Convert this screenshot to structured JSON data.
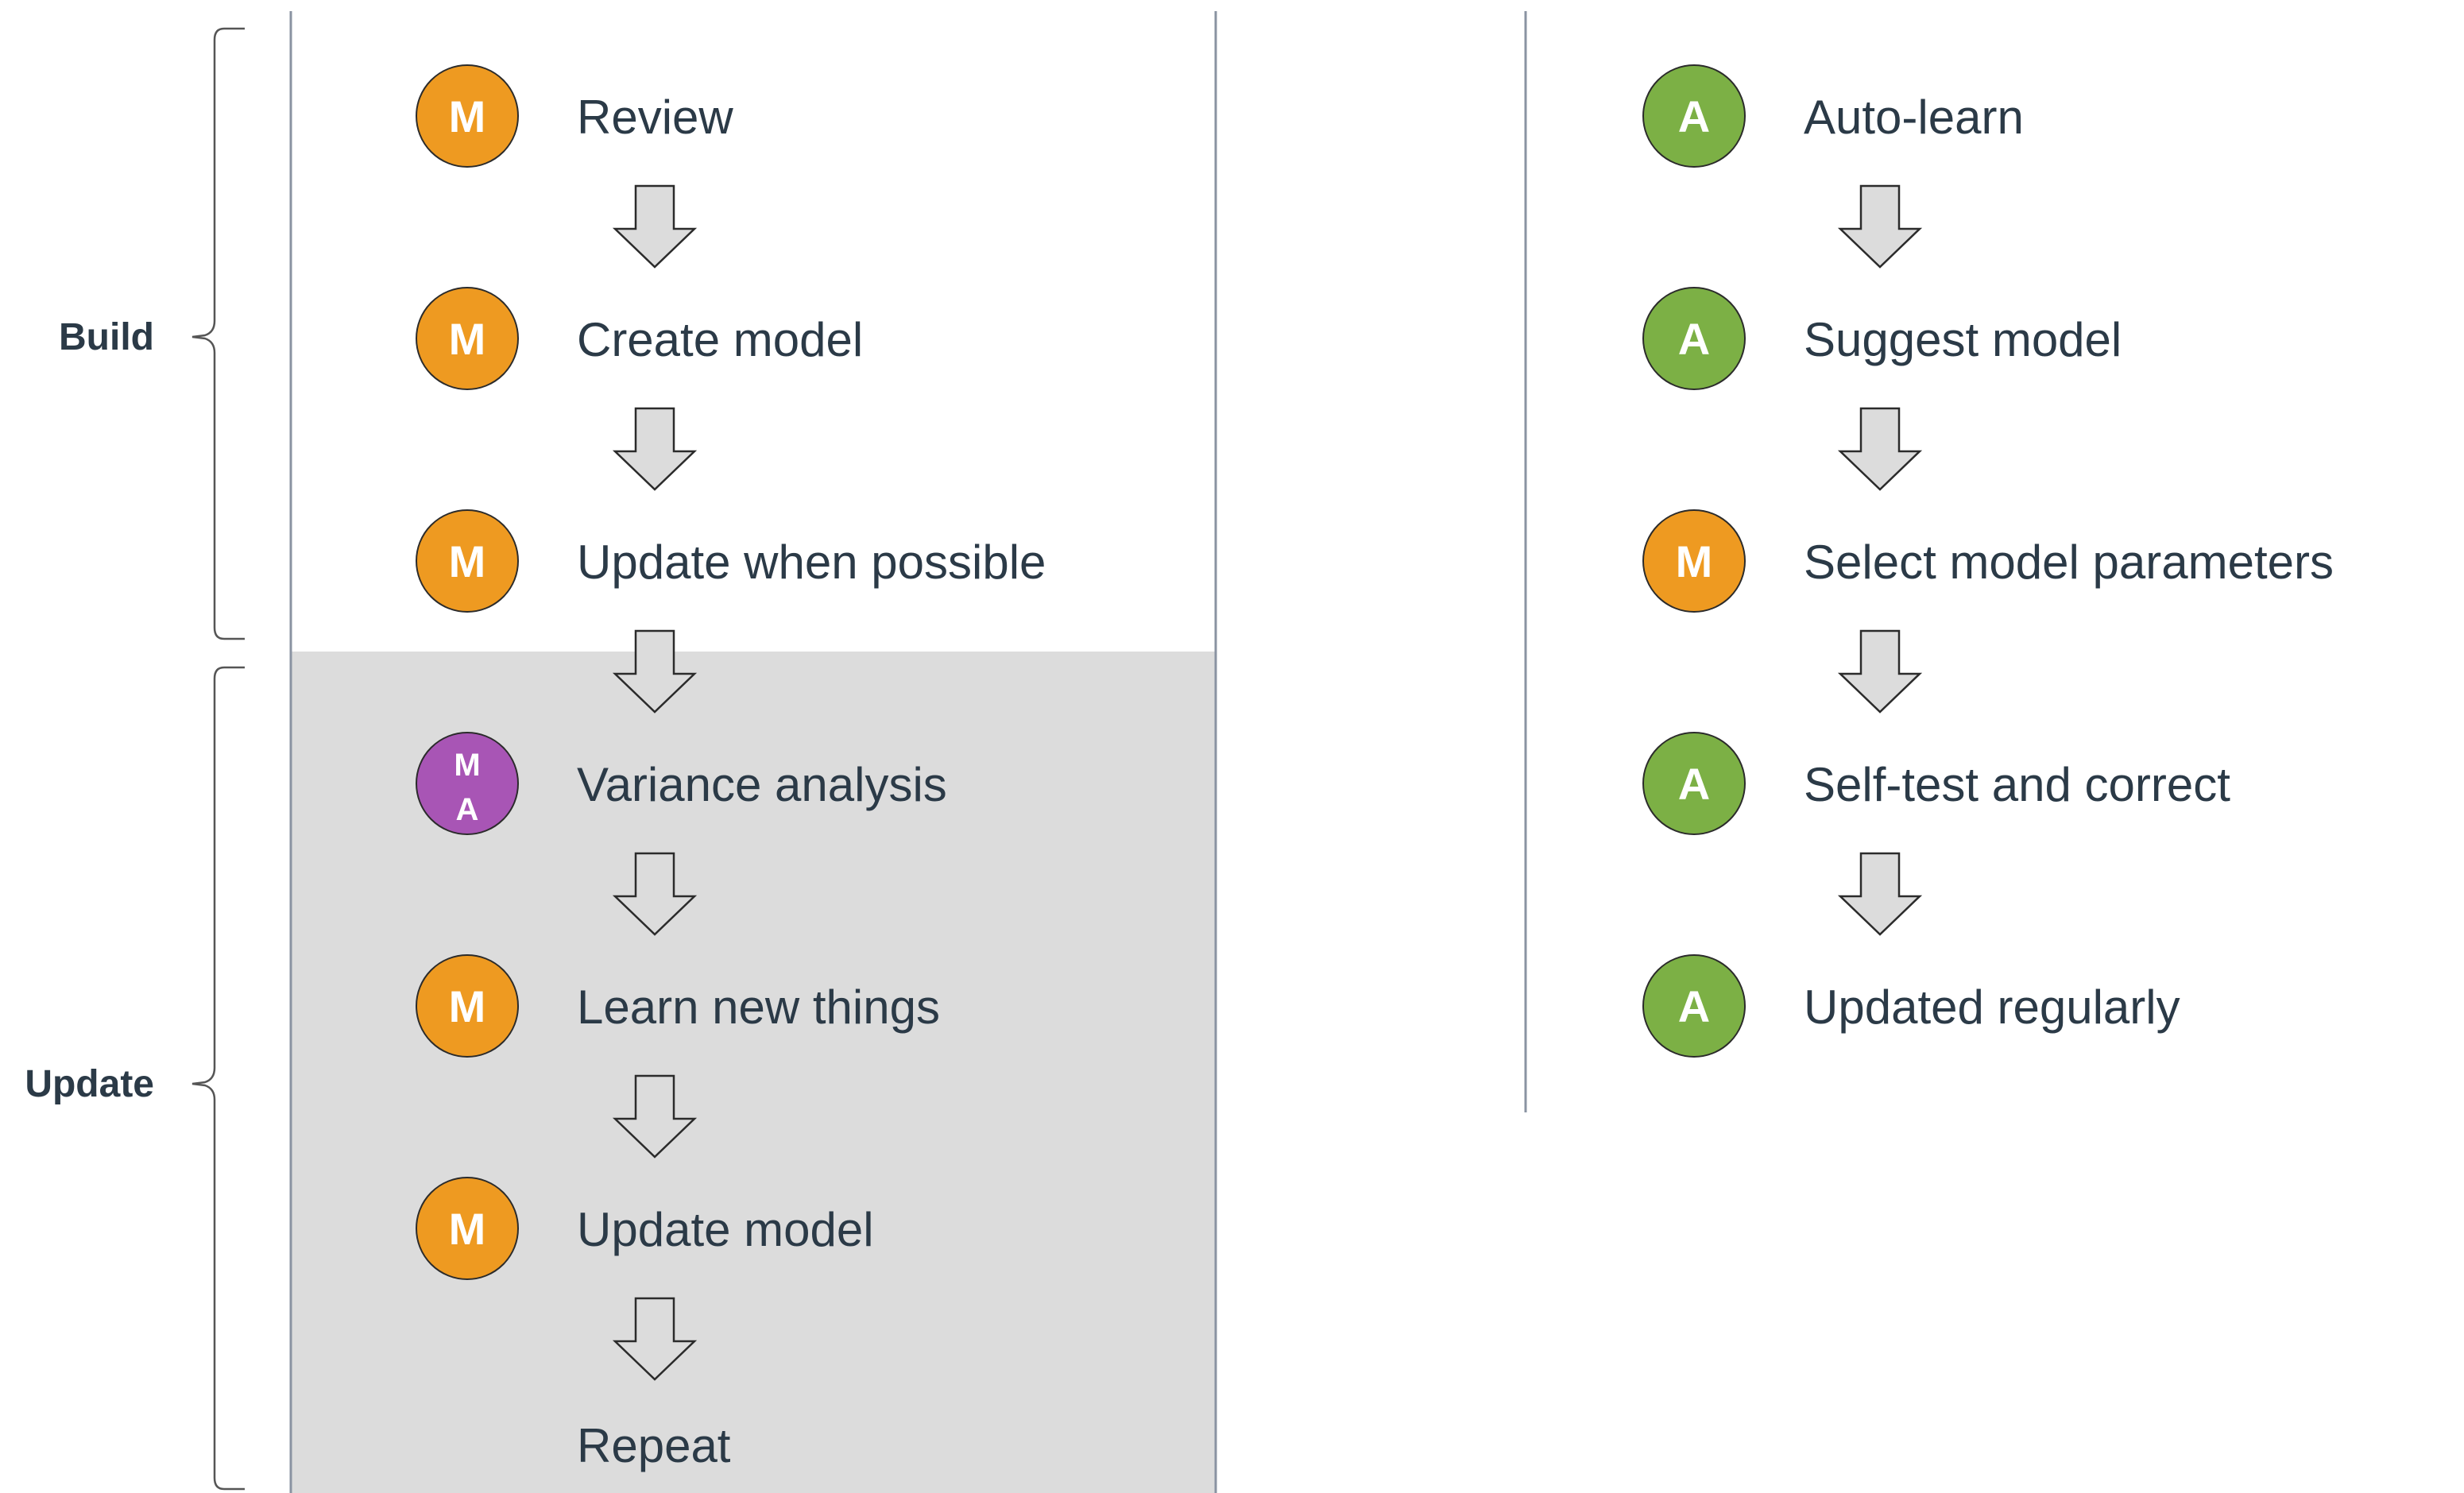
{
  "colors": {
    "manual": "#EE9A21",
    "automated": "#7CB045",
    "mixed": "#A855B5",
    "update_band": "#DCDCDC",
    "divider": "#8A93A2",
    "arrow_fill": "#DCDCDC",
    "arrow_stroke": "#2b2b2b",
    "text": "#2b3a47"
  },
  "phases": {
    "build": "Build",
    "update": "Update"
  },
  "left_flow": [
    {
      "badge": [
        "M"
      ],
      "kind": "manual",
      "label": "Review"
    },
    {
      "badge": [
        "M"
      ],
      "kind": "manual",
      "label": "Create model"
    },
    {
      "badge": [
        "M"
      ],
      "kind": "manual",
      "label": "Update when possible"
    },
    {
      "badge": [
        "M",
        "A"
      ],
      "kind": "mixed",
      "label": "Variance analysis"
    },
    {
      "badge": [
        "M"
      ],
      "kind": "manual",
      "label": "Learn new things"
    },
    {
      "badge": [
        "M"
      ],
      "kind": "manual",
      "label": "Update model"
    },
    {
      "badge": [],
      "kind": "none",
      "label": "Repeat"
    }
  ],
  "right_flow": [
    {
      "badge": [
        "A"
      ],
      "kind": "automated",
      "label": "Auto-learn"
    },
    {
      "badge": [
        "A"
      ],
      "kind": "automated",
      "label": "Suggest model"
    },
    {
      "badge": [
        "M"
      ],
      "kind": "manual",
      "label": "Select model parameters"
    },
    {
      "badge": [
        "A"
      ],
      "kind": "automated",
      "label": "Self-test and correct"
    },
    {
      "badge": [
        "A"
      ],
      "kind": "automated",
      "label": "Updated regularly"
    }
  ],
  "icons": {
    "arrow": "down-arrow-icon",
    "brace": "curly-brace-icon"
  }
}
